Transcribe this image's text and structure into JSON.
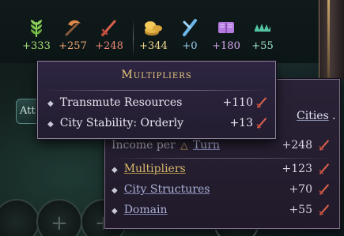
{
  "resources": [
    {
      "icon": "food-icon",
      "value": "+333",
      "color": "#a6e37a"
    },
    {
      "icon": "industry-icon",
      "value": "+257",
      "color": "#f0a573"
    },
    {
      "icon": "military-icon",
      "value": "+248",
      "color": "#ef8a79"
    },
    {
      "icon": "gold-icon",
      "value": "+344",
      "color": "#f2da8c"
    },
    {
      "icon": "science-icon",
      "value": "+0",
      "color": "#9ed0ef"
    },
    {
      "icon": "influence-icon",
      "value": "+180",
      "color": "#d9a9f0"
    },
    {
      "icon": "population-icon",
      "value": "+55",
      "color": "#9ee7cf"
    }
  ],
  "background": {
    "attr_button": "Att"
  },
  "income_tooltip": {
    "cities_link": "Cities",
    "income_label": "Income per",
    "turn_link": "Turn",
    "income_total": "+248",
    "rows": [
      {
        "label": "Multipliers",
        "value": "+123",
        "style": "gold"
      },
      {
        "label": "City Structures",
        "value": "+70",
        "style": "blue"
      },
      {
        "label": "Domain",
        "value": "+55",
        "style": "blue"
      }
    ]
  },
  "multipliers_tooltip": {
    "title": "Multipliers",
    "rows": [
      {
        "label": "Transmute Resources",
        "value": "+110"
      },
      {
        "label": "City Stability: Orderly",
        "value": "+13"
      }
    ]
  }
}
